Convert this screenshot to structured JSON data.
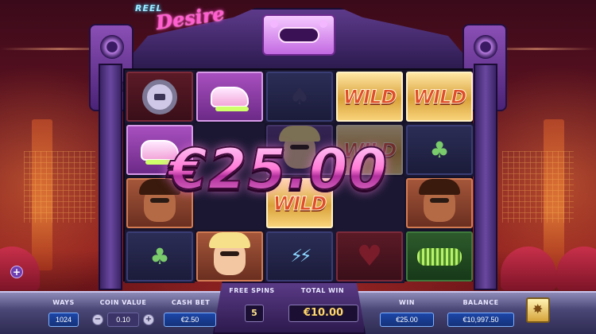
{
  "game": {
    "logo_text": "Reel Desire"
  },
  "overlay": {
    "big_win": "€25.00"
  },
  "reels": {
    "wild_label": "WILD"
  },
  "console": {
    "ways_label": "WAYS",
    "ways_value": "1024",
    "coin_value_label": "COIN VALUE",
    "coin_value": "0.10",
    "coin_minus": "−",
    "coin_plus": "+",
    "cash_bet_label": "CASH BET",
    "cash_bet_value": "€2.50",
    "free_spins_label": "FREE SPINS",
    "free_spins_value": "5",
    "total_win_label": "TOTAL WIN",
    "total_win_value": "€10.00",
    "win_label": "WIN",
    "win_value": "€25.00",
    "balance_label": "BALANCE",
    "balance_value": "€10,997.50",
    "side_plus": "+"
  },
  "icons": [
    "watch-icon",
    "sneaker-icon",
    "spade-icon",
    "club-icon",
    "heart-icon",
    "portrait-icon",
    "shades-icon",
    "diamond-icon",
    "menu-icon",
    "plus-icon"
  ],
  "colors": {
    "big_win": "#ff7ad6",
    "field_blue": "#1c46a8",
    "wild_red": "#e04d2a",
    "gold_tile": "#d9a13a"
  }
}
